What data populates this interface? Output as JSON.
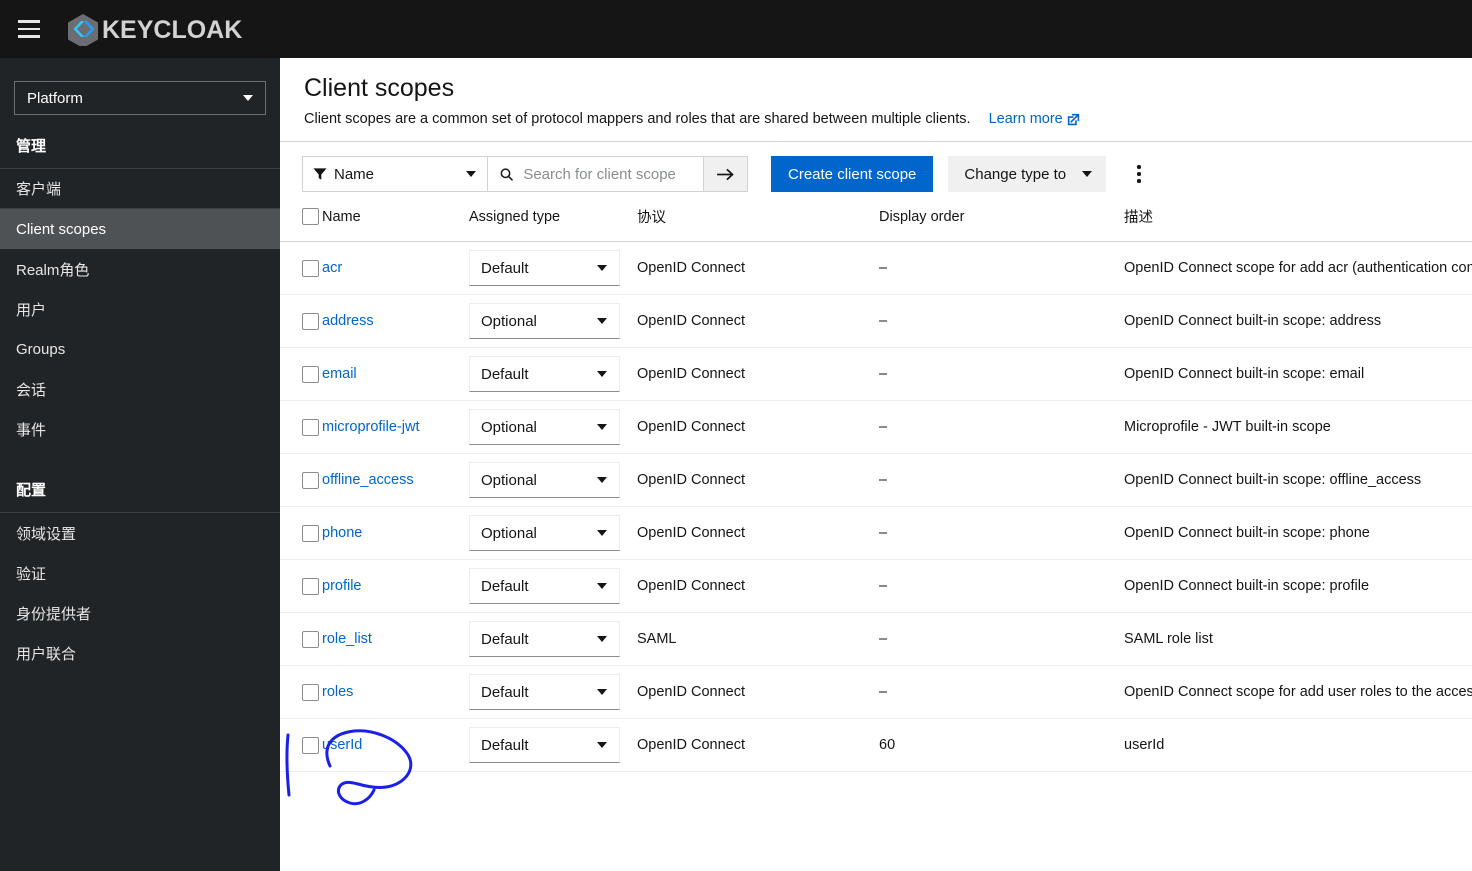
{
  "masthead": {
    "menu_icon": "hamburger-icon",
    "brand_name": "KEYCLOAK",
    "logo_icon": "keycloak-logo-icon"
  },
  "sidebar": {
    "realm_selector": {
      "value": "Platform",
      "icon": "chevron-down-icon"
    },
    "sections": [
      {
        "title": "管理",
        "items": [
          {
            "label": "客户端",
            "active": false
          },
          {
            "label": "Client scopes",
            "active": true
          },
          {
            "label": "Realm角色",
            "active": false
          },
          {
            "label": "用户",
            "active": false
          },
          {
            "label": "Groups",
            "active": false
          },
          {
            "label": "会话",
            "active": false
          },
          {
            "label": "事件",
            "active": false
          }
        ]
      },
      {
        "title": "配置",
        "items": [
          {
            "label": "领域设置",
            "active": false
          },
          {
            "label": "验证",
            "active": false
          },
          {
            "label": "身份提供者",
            "active": false
          },
          {
            "label": "用户联合",
            "active": false
          }
        ]
      }
    ]
  },
  "page": {
    "title": "Client scopes",
    "subtitle": "Client scopes are a common set of protocol mappers and roles that are shared between multiple clients.",
    "learn_more": "Learn more"
  },
  "toolbar": {
    "filter_label": "Name",
    "filter_icon": "filter-funnel-icon",
    "search_placeholder": "Search for client scope",
    "search_value": "",
    "search_icon": "search-icon",
    "search_go_icon": "arrow-right-icon",
    "create_label": "Create client scope",
    "change_type_label": "Change type to",
    "kebab_icon": "kebab-menu-icon"
  },
  "table": {
    "columns": [
      "Name",
      "Assigned type",
      "协议",
      "Display order",
      "描述"
    ],
    "rows": [
      {
        "name": "acr",
        "assigned_type": "Default",
        "protocol": "OpenID Connect",
        "display_order": "–",
        "description": "OpenID Connect scope for add acr (authentication context class reference) to the token"
      },
      {
        "name": "address",
        "assigned_type": "Optional",
        "protocol": "OpenID Connect",
        "display_order": "–",
        "description": "OpenID Connect built-in scope: address"
      },
      {
        "name": "email",
        "assigned_type": "Default",
        "protocol": "OpenID Connect",
        "display_order": "–",
        "description": "OpenID Connect built-in scope: email"
      },
      {
        "name": "microprofile-jwt",
        "assigned_type": "Optional",
        "protocol": "OpenID Connect",
        "display_order": "–",
        "description": "Microprofile - JWT built-in scope"
      },
      {
        "name": "offline_access",
        "assigned_type": "Optional",
        "protocol": "OpenID Connect",
        "display_order": "–",
        "description": "OpenID Connect built-in scope: offline_access"
      },
      {
        "name": "phone",
        "assigned_type": "Optional",
        "protocol": "OpenID Connect",
        "display_order": "–",
        "description": "OpenID Connect built-in scope: phone"
      },
      {
        "name": "profile",
        "assigned_type": "Default",
        "protocol": "OpenID Connect",
        "display_order": "–",
        "description": "OpenID Connect built-in scope: profile"
      },
      {
        "name": "role_list",
        "assigned_type": "Default",
        "protocol": "SAML",
        "display_order": "–",
        "description": "SAML role list"
      },
      {
        "name": "roles",
        "assigned_type": "Default",
        "protocol": "OpenID Connect",
        "display_order": "–",
        "description": "OpenID Connect scope for add user roles to the access token"
      },
      {
        "name": "userId",
        "assigned_type": "Default",
        "protocol": "OpenID Connect",
        "display_order": "60",
        "description": "userId"
      }
    ]
  },
  "annotation": {
    "color": "#1a20e8",
    "target": "userId"
  },
  "colors": {
    "masthead_bg": "#151515",
    "sidebar_bg": "#212427",
    "sidebar_active_bg": "#4f5255",
    "primary_blue": "#0066cc",
    "link_blue": "#006bd6"
  }
}
